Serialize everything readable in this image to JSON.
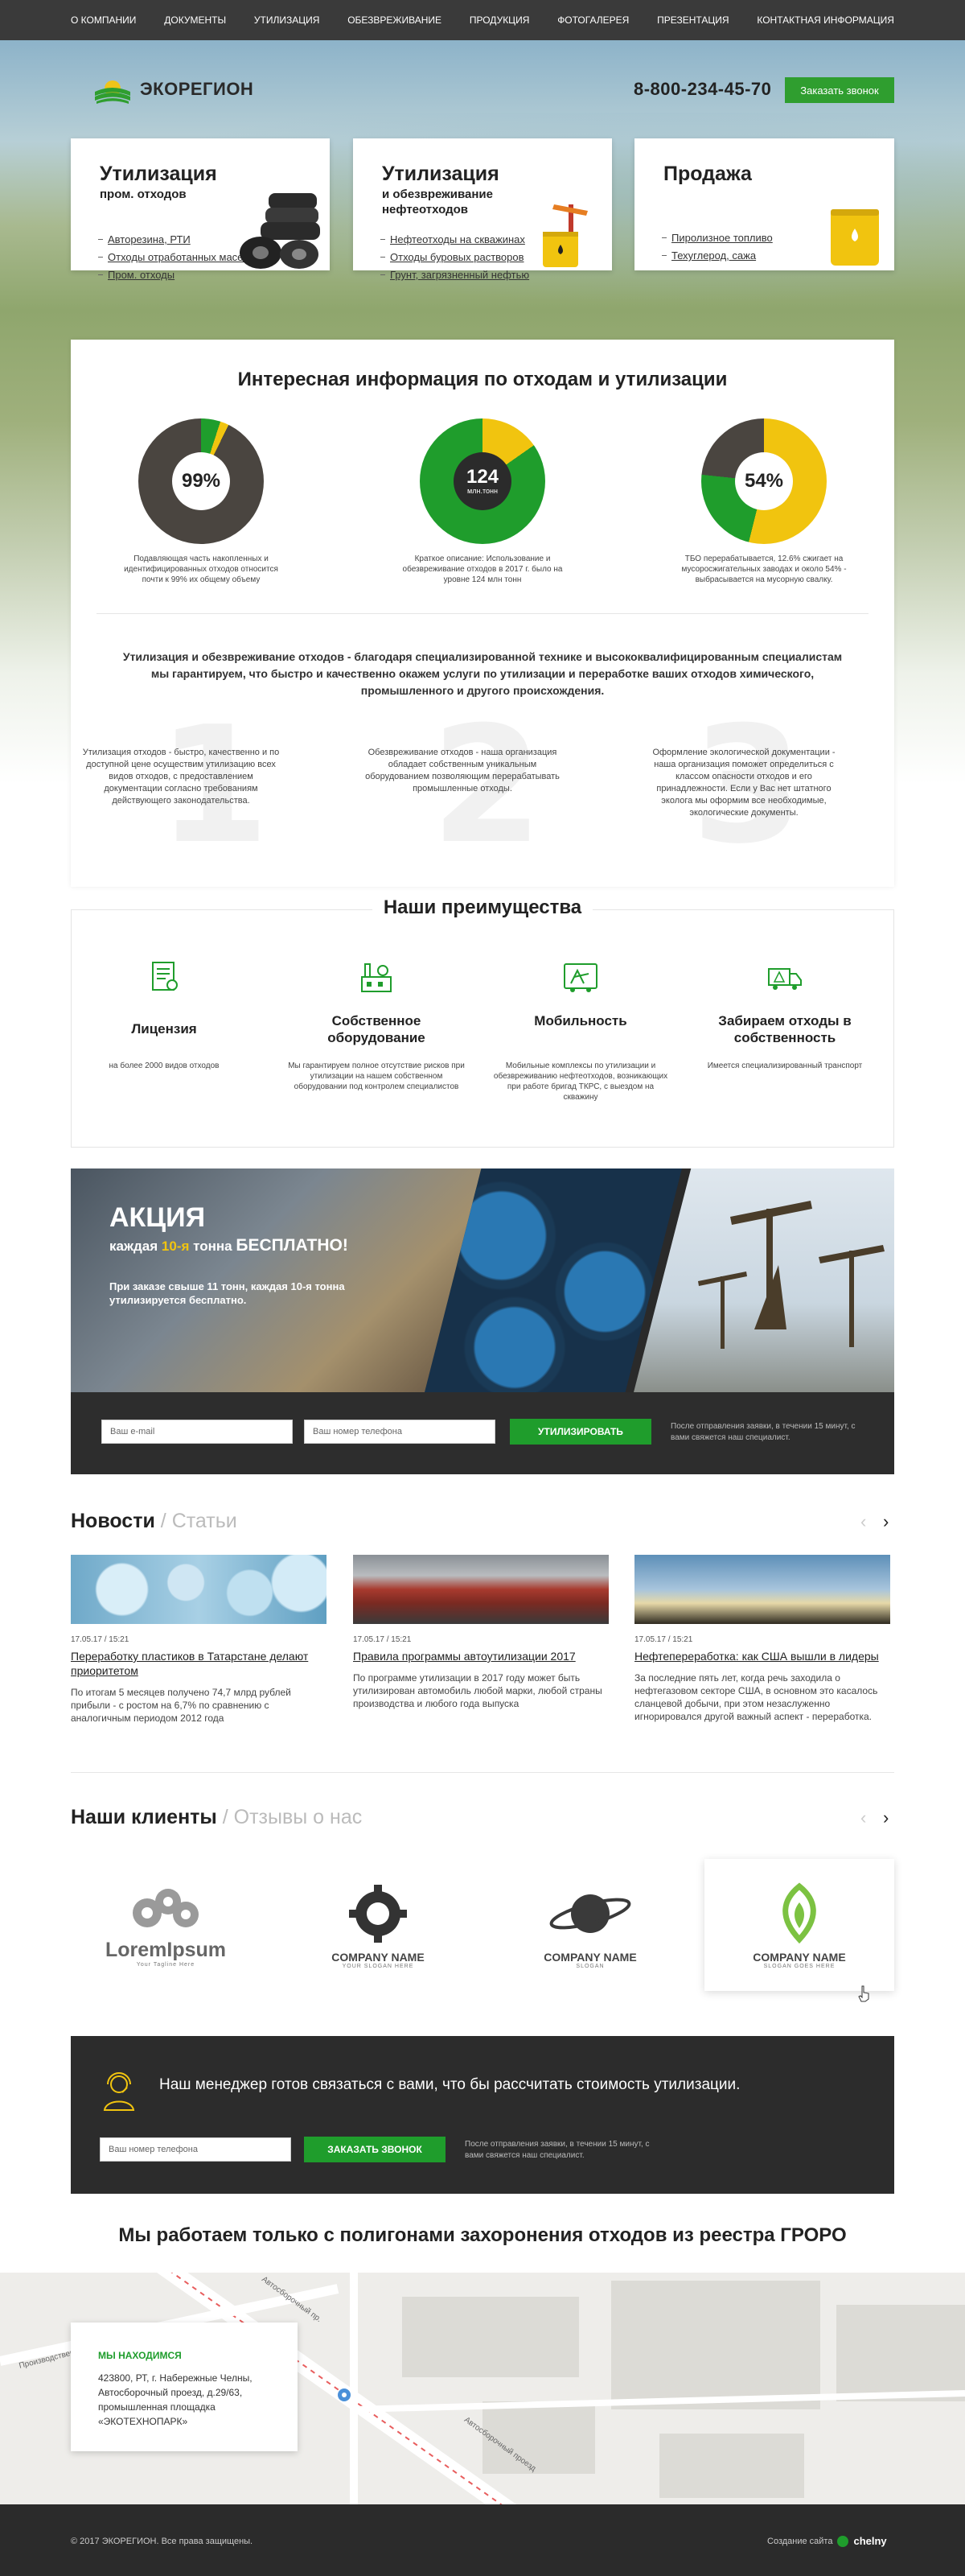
{
  "nav": [
    "О КОМПАНИИ",
    "ДОКУМЕНТЫ",
    "УТИЛИЗАЦИЯ",
    "ОБЕЗВРЕЖИВАНИЕ",
    "ПРОДУКЦИЯ",
    "ФОТОГАЛЕРЕЯ",
    "ПРЕЗЕНТАЦИЯ",
    "КОНТАКТНАЯ ИНФОРМАЦИЯ"
  ],
  "header": {
    "logo": "ЭКОРЕГИОН",
    "phone": "8-800-234-45-70",
    "call_button": "Заказать звонок"
  },
  "cards": [
    {
      "title": "Утилизация",
      "subtitle": "пром. отходов",
      "links": [
        "Авторезина, РТИ",
        "Отходы отработанных масел",
        "Пром. отходы"
      ]
    },
    {
      "title": "Утилизация",
      "subtitle": "и обезвреживание нефтеотходов",
      "links": [
        "Нефтеотходы на скважинах",
        "Отходы буровых растворов",
        "Грунт, загрязненный нефтью"
      ]
    },
    {
      "title": "Продажа",
      "subtitle": "",
      "links": [
        "Пиролизное топливо",
        "Техуглерод, сажа"
      ]
    }
  ],
  "info": {
    "title": "Интересная информация по отходам и утилизации",
    "stats": [
      {
        "value": "99%",
        "unit": "",
        "fraction": 0.99,
        "caption": "Подавляющая часть накопленных и идентифицированных отходов относится почти к 99% их общему объему"
      },
      {
        "value": "124",
        "unit": "млн.тонн",
        "fraction": 0.85,
        "caption": "Краткое описание: Использование и обезвреживание отходов в 2017 г. было на уровне 124 млн тонн"
      },
      {
        "value": "54%",
        "unit": "",
        "fraction": 0.54,
        "caption": "ТБО перерабатывается, 12.6% сжигает на мусоросжигательных заводах и около 54% - выбрасывается на мусорную свалку."
      }
    ],
    "lead": "Утилизация и обезвреживание отходов - благодаря специализированной технике и высококвалифицированным специалистам мы гарантируем, что быстро и качественно окажем услуги по утилизации и переработке ваших отходов химического, промышленного и другого происхождения.",
    "columns": [
      {
        "num": "1",
        "text": "Утилизация отходов - быстро, качественно и по доступной цене осуществим утилизацию всех видов отходов, с предоставлением документации согласно требованиям действующего законодательства."
      },
      {
        "num": "2",
        "text": "Обезвреживание отходов - наша организация обладает собственным уникальным оборудованием позволяющим перерабатывать промышленные отходы."
      },
      {
        "num": "3",
        "text": "Оформление экологической документации - наша организация поможет определиться с классом опасности отходов и его принадлежности. Если у Вас нет штатного эколога мы оформим все необходимые, экологические документы."
      }
    ]
  },
  "advantages": {
    "title": "Наши преимущества",
    "items": [
      {
        "title": "Лицензия",
        "text": "на более 2000 видов отходов"
      },
      {
        "title": "Собственное оборудование",
        "text": "Мы гарантируем полное отсутствие рисков при утилизации на нашем собственном оборудовании под контролем специалистов"
      },
      {
        "title": "Мобильность",
        "text": "Мобильные комплексы по утилизации и обезвреживанию нефтеотходов, возникающих при работе бригад ТКРС, с выездом на скважину"
      },
      {
        "title": "Забираем отходы в собственность",
        "text": "Имеется специализированный транспорт"
      }
    ]
  },
  "promo": {
    "title": "АКЦИЯ",
    "subtitle_pre": "каждая ",
    "subtitle_num": "10-я",
    "subtitle_mid": " тонна ",
    "subtitle_free": "БЕСПЛАТНО!",
    "body": "При заказе свыше 11 тонн, каждая 10-я тонна утилизируется бесплатно.",
    "email_placeholder": "Ваш e-mail",
    "phone_placeholder": "Ваш номер телефона",
    "button": "УТИЛИЗИРОВАТЬ",
    "note": "После отправления заявки, в течении 15 минут, с вами свяжется наш специалист."
  },
  "news": {
    "title": "Новости",
    "separator": "/",
    "alt_title": "Статьи",
    "items": [
      {
        "date": "17.05.17 / 15:21",
        "title": "Переработку пластиков в Татарстане делают приоритетом",
        "text": "По итогам 5 месяцев получено 74,7 млрд рублей прибыли - с ростом на 6,7% по сравнению с аналогичным периодом 2012 года"
      },
      {
        "date": "17.05.17 / 15:21",
        "title": "Правила программы автоутилизации 2017",
        "text": "По программе утилизации в 2017 году может быть утилизирован автомобиль любой марки, любой страны производства и любого года выпуска"
      },
      {
        "date": "17.05.17 / 15:21",
        "title": "Нефтепереработка: как США вышли в лидеры",
        "text": "За последние пять лет, когда речь заходила о нефтегазовом секторе США, в основном это касалось сланцевой добычи, при этом незаслуженно игнорировался другой важный аспект - переработка."
      }
    ]
  },
  "clients": {
    "title": "Наши клиенты",
    "separator": "/",
    "alt_title": "Отзывы о нас",
    "items": [
      {
        "name": "LoremIpsum",
        "slogan": "Your Tagline Here"
      },
      {
        "name": "COMPANY NAME",
        "slogan": "YOUR SLOGAN HERE"
      },
      {
        "name": "COMPANY NAME",
        "slogan": "SLOGAN"
      },
      {
        "name": "COMPANY NAME",
        "slogan": "SLOGAN GOES HERE"
      }
    ]
  },
  "manager": {
    "text": "Наш менеджер готов связаться с вами, что бы рассчитать стоимость утилизации.",
    "phone_placeholder": "Ваш номер телефона",
    "button": "ЗАКАЗАТЬ ЗВОНОК",
    "note": "После отправления заявки, в течении 15 минут, с вами свяжется наш специалист."
  },
  "registry": "Мы работаем только с полигонами захоронения отходов из реестра ГРОРО",
  "map": {
    "box_title": "МЫ НАХОДИМСЯ",
    "address": [
      "423800, РТ, г. Набережные Челны,",
      "Автосборочный проезд, д.29/63,",
      "промышленная площадка",
      "«ЭКОТЕХНОПАРК»"
    ],
    "street_labels": [
      "Автосборочный проезд",
      "Автосборочный пр.",
      "Производственный проезд"
    ]
  },
  "footer": {
    "copyright": "© 2017 ЭКОРЕГИОН. Все права защищены.",
    "credit": "Создание сайта",
    "credit_brand": "chelny"
  },
  "colors": {
    "green": "#1f9d2c",
    "yellow": "#f1c40f",
    "dark": "#4a4540",
    "black": "#2b2b2b"
  }
}
